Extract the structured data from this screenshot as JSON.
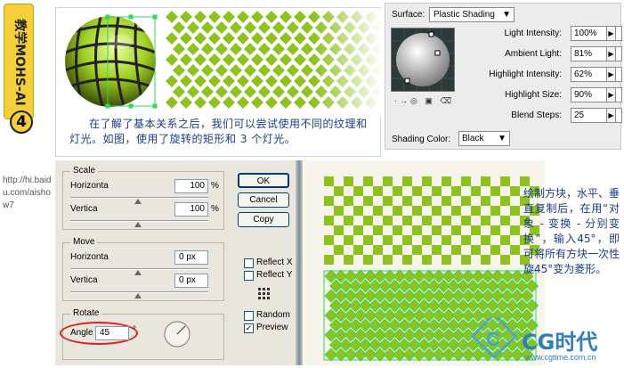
{
  "sidebar": {
    "title": "教学MOHS-AI",
    "step": "4",
    "url": "http://hi.baidu.com/aishow7"
  },
  "caption_top": "在了解了基本关系之后，我们可以尝试使用不同的纹理和灯光。如图，使用了旋转的矩形和 3 个灯光。",
  "caption_right": "绘制方块，水平、垂直复制后，在用“对象 - 变换 - 分别变换”，输入45°，即可将所有方块一次性旋45°变为菱形。",
  "shading_panel": {
    "surface_label": "Surface:",
    "surface_value": "Plastic Shading",
    "light_intensity_label": "Light Intensity:",
    "light_intensity": "100%",
    "ambient_light_label": "Ambient Light:",
    "ambient_light": "81%",
    "highlight_intensity_label": "Highlight Intensity:",
    "highlight_intensity": "62%",
    "highlight_size_label": "Highlight Size:",
    "highlight_size": "90%",
    "blend_steps_label": "Blend Steps:",
    "blend_steps": "25",
    "shading_color_label": "Shading Color:",
    "shading_color": "Black"
  },
  "transform_dialog": {
    "scale_title": "Scale",
    "scale_h_label": "Horizonta",
    "scale_h": "100",
    "scale_v_label": "Vertica",
    "scale_v": "100",
    "pct": "%",
    "move_title": "Move",
    "move_h_label": "Horizonta",
    "move_h": "0 px",
    "move_v_label": "Vertica",
    "move_v": "0 px",
    "rotate_title": "Rotate",
    "angle_label": "Angle",
    "angle": "45",
    "deg": "°",
    "ok": "OK",
    "cancel": "Cancel",
    "copy": "Copy",
    "reflect_x": "Reflect X",
    "reflect_y": "Reflect Y",
    "random": "Random",
    "preview": "Preview"
  },
  "logo": {
    "text": "CG时代",
    "url": "www.cgtime.com.cn"
  },
  "colors": {
    "green": "#8dc21f",
    "select": "#35d45a",
    "caption": "#1b3b8a"
  }
}
